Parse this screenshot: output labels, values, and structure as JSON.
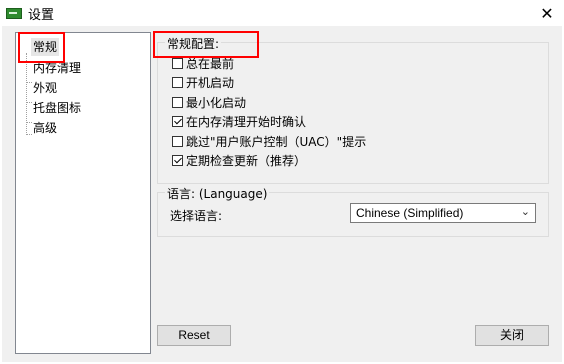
{
  "window": {
    "title": "设置",
    "close_glyph": "✕"
  },
  "tree": {
    "items": [
      {
        "label": "常规",
        "selected": true
      },
      {
        "label": "内存清理"
      },
      {
        "label": "外观"
      },
      {
        "label": "托盘图标"
      },
      {
        "label": "高级"
      }
    ]
  },
  "general_group": {
    "title": "常规配置:",
    "checkboxes": [
      {
        "label": "总在最前",
        "checked": false
      },
      {
        "label": "开机启动",
        "checked": false
      },
      {
        "label": "最小化启动",
        "checked": false
      },
      {
        "label": "在内存清理开始时确认",
        "checked": true
      },
      {
        "label": "跳过\"用户账户控制（UAC）\"提示",
        "checked": false
      },
      {
        "label": "定期检查更新（推荐）",
        "checked": true
      }
    ]
  },
  "language_group": {
    "title": "语言: (Language)",
    "select_label": "选择语言:",
    "select_value": "Chinese (Simplified)"
  },
  "buttons": {
    "reset": "Reset",
    "close": "关闭"
  },
  "colors": {
    "highlight_box": "#ff0000",
    "app_icon": "#2e8b2e"
  }
}
